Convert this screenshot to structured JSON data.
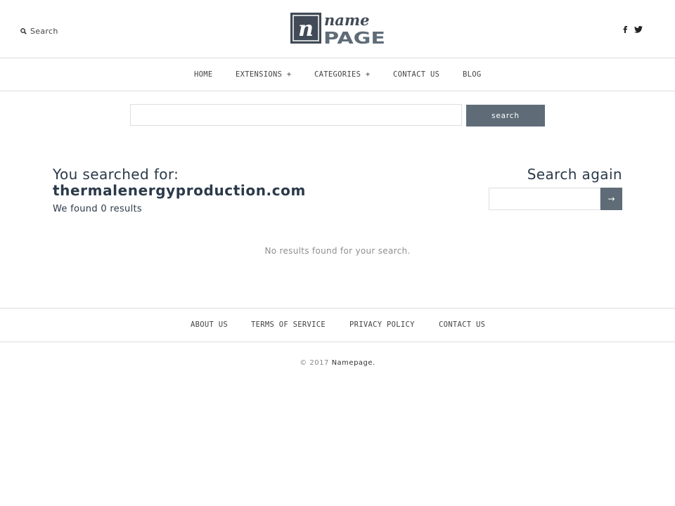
{
  "header": {
    "search_label": "Search",
    "logo": {
      "mark": "n",
      "word_top": "name",
      "word_bottom": "PAGE",
      "color": "#414a56"
    },
    "social": {
      "facebook_icon": "facebook-icon",
      "twitter_icon": "twitter-icon"
    }
  },
  "nav": {
    "items": [
      {
        "label": "HOME"
      },
      {
        "label": "EXTENSIONS +"
      },
      {
        "label": "CATEGORIES +"
      },
      {
        "label": "CONTACT US"
      },
      {
        "label": "BLOG"
      }
    ]
  },
  "main_search": {
    "value": "",
    "placeholder": "",
    "button_label": "search"
  },
  "results": {
    "heading": "You searched for:",
    "query": "thermalenergyproduction.com",
    "count_text": "We found 0 results",
    "empty_message": "No results found for your search."
  },
  "search_again": {
    "heading": "Search again",
    "value": "",
    "button_label": "→"
  },
  "footer": {
    "items": [
      {
        "label": "ABOUT US"
      },
      {
        "label": "TERMS OF SERVICE"
      },
      {
        "label": "PRIVACY POLICY"
      },
      {
        "label": "CONTACT US"
      }
    ],
    "copyright_prefix": "© 2017",
    "copyright_brand": "Namepage."
  },
  "colors": {
    "accent": "#5f6c78",
    "heading": "#2b3a4a",
    "border": "#dcdcdc"
  }
}
